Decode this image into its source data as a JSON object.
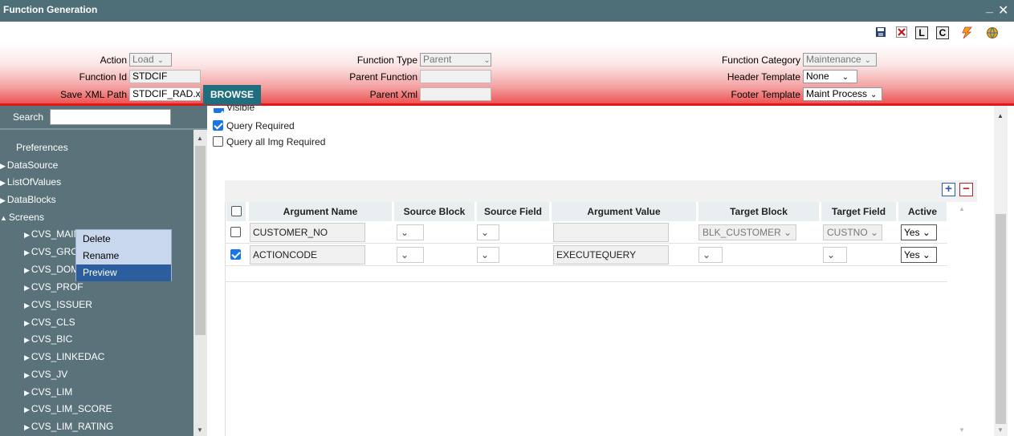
{
  "window": {
    "title": "Function Generation",
    "minimize": "_",
    "close": "✕"
  },
  "toolbar": {
    "save_icon": "save-icon",
    "delete_icon": "delete-icon",
    "l_label": "L",
    "c_label": "C",
    "lightning_icon": "lightning-icon",
    "globe_icon": "globe-icon"
  },
  "header": {
    "action_label": "Action",
    "action_value": "Load",
    "function_id_label": "Function Id",
    "function_id_value": "STDCIF",
    "save_xml_label": "Save XML Path",
    "save_xml_value": "STDCIF_RAD.x",
    "browse_label": "BROWSE",
    "function_type_label": "Function Type",
    "function_type_value": "Parent",
    "parent_function_label": "Parent Function",
    "parent_function_value": "",
    "parent_xml_label": "Parent Xml",
    "parent_xml_value": "",
    "function_category_label": "Function Category",
    "function_category_value": "Maintenance",
    "header_template_label": "Header Template",
    "header_template_value": "None",
    "footer_template_label": "Footer Template",
    "footer_template_value": "Maint Process"
  },
  "sidebar": {
    "search_label": "Search",
    "search_value": "",
    "items": [
      {
        "label": "Preferences",
        "type": "leaf"
      },
      {
        "label": "DataSource",
        "type": "collapsed"
      },
      {
        "label": "ListOfValues",
        "type": "collapsed"
      },
      {
        "label": "DataBlocks",
        "type": "collapsed"
      },
      {
        "label": "Screens",
        "type": "expanded"
      },
      {
        "label": "CVS_MAIN",
        "type": "child"
      },
      {
        "label": "CVS_GRO",
        "type": "child"
      },
      {
        "label": "CVS_DOM",
        "type": "child"
      },
      {
        "label": "CVS_PROF",
        "type": "child"
      },
      {
        "label": "CVS_ISSUER",
        "type": "child"
      },
      {
        "label": "CVS_CLS",
        "type": "child"
      },
      {
        "label": "CVS_BIC",
        "type": "child"
      },
      {
        "label": "CVS_LINKEDAC",
        "type": "child"
      },
      {
        "label": "CVS_JV",
        "type": "child"
      },
      {
        "label": "CVS_LIM",
        "type": "child"
      },
      {
        "label": "CVS_LIM_SCORE",
        "type": "child"
      },
      {
        "label": "CVS_LIM_RATING",
        "type": "child"
      }
    ]
  },
  "context_menu": {
    "items": [
      "Delete",
      "Rename",
      "Preview"
    ],
    "active": "Preview"
  },
  "options": {
    "visible_label": "Visible",
    "query_required_label": "Query Required",
    "query_required_checked": true,
    "query_all_img_label": "Query all Img Required",
    "query_all_img_checked": false
  },
  "grid": {
    "add_label": "+",
    "remove_label": "−",
    "columns": [
      "Argument Name",
      "Source Block",
      "Source Field",
      "Argument Value",
      "Target Block",
      "Target Field",
      "Active"
    ],
    "rows": [
      {
        "checked": false,
        "argument_name": "CUSTOMER_NO",
        "argument_value": "",
        "target_block": "BLK_CUSTOMER",
        "target_field": "CUSTNO",
        "active": "Yes"
      },
      {
        "checked": true,
        "argument_name": "ACTIONCODE",
        "argument_value": "EXECUTEQUERY",
        "target_block": "",
        "target_field": "",
        "active": "Yes"
      }
    ]
  },
  "colors": {
    "titlebar": "#4e6e78",
    "sidebar": "#5a737b",
    "header_accent": "#e01818",
    "browse": "#1e6e7e",
    "context_active": "#2c5e9e"
  }
}
